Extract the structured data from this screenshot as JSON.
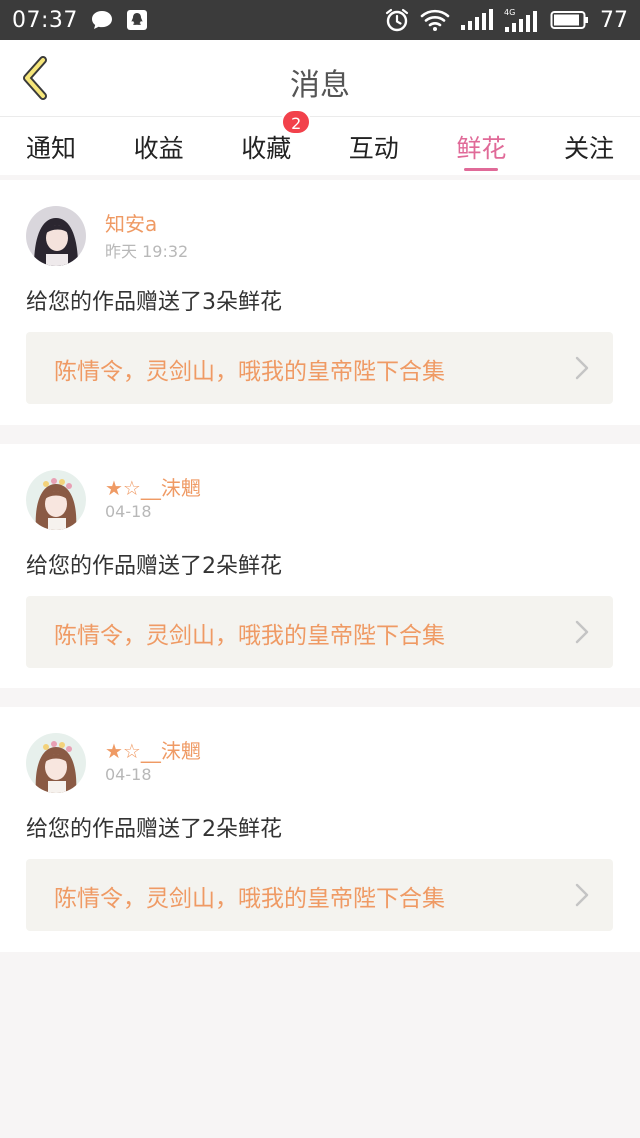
{
  "status_bar": {
    "time": "07:37",
    "battery": "77",
    "icons_left": [
      "message-bubble-icon",
      "qq-icon"
    ],
    "icons_right": [
      "alarm-icon",
      "wifi-icon",
      "signal-icon",
      "signal-4g-icon",
      "battery-icon"
    ]
  },
  "header": {
    "title": "消息",
    "back_icon": "chevron-left-icon"
  },
  "tabs": [
    {
      "label": "通知"
    },
    {
      "label": "收益"
    },
    {
      "label": "收藏",
      "badge": "2"
    },
    {
      "label": "互动"
    },
    {
      "label": "鲜花",
      "active": true
    },
    {
      "label": "关注"
    }
  ],
  "messages": [
    {
      "username": "知安a",
      "time": "昨天 19:32",
      "text": "给您的作品赠送了3朵鲜花",
      "work_title": "陈情令，灵剑山，哦我的皇帝陛下合集"
    },
    {
      "username": "★☆__沫魍",
      "time": "04-18",
      "text": "给您的作品赠送了2朵鲜花",
      "work_title": "陈情令，灵剑山，哦我的皇帝陛下合集"
    },
    {
      "username": "★☆__沫魍",
      "time": "04-18",
      "text": "给您的作品赠送了2朵鲜花",
      "work_title": "陈情令，灵剑山，哦我的皇帝陛下合集"
    }
  ],
  "colors": {
    "accent": "#e06a98",
    "username": "#ef9a64",
    "badge": "#f2414b",
    "status_bar": "#3b3b3b"
  }
}
